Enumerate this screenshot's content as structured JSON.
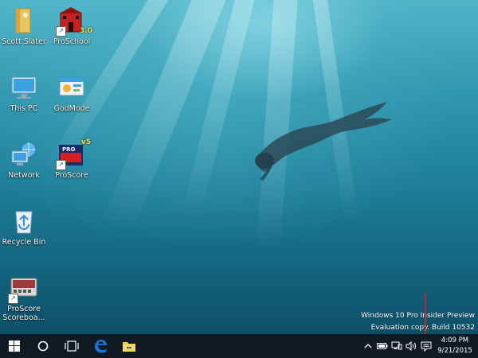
{
  "desktop": {
    "icons": [
      {
        "label": "Scott Slater",
        "icon": "user-folder-icon"
      },
      {
        "label": "ProSchool",
        "icon": "proschool-app-icon",
        "badge": "3.0"
      },
      {
        "label": "This PC",
        "icon": "computer-icon"
      },
      {
        "label": "GodMode",
        "icon": "control-panel-folder-icon"
      },
      {
        "label": "Network",
        "icon": "network-icon"
      },
      {
        "label": "ProScore",
        "icon": "proscore-app-icon",
        "badge": "v5"
      },
      {
        "label": "Recycle Bin",
        "icon": "recycle-bin-icon"
      },
      {
        "label": "ProScore Scoreboa...",
        "label_line1": "ProScore",
        "label_line2": "Scoreboa...",
        "icon": "scoreboard-app-icon"
      }
    ],
    "watermark": {
      "line1": "Windows 10 Pro Insider Preview",
      "line2": "Evaluation copy. Build 10532"
    }
  },
  "taskbar": {
    "buttons": [
      {
        "name": "start",
        "icon": "windows-logo-icon"
      },
      {
        "name": "search",
        "icon": "cortana-circle-icon"
      },
      {
        "name": "task-view",
        "icon": "task-view-icon"
      },
      {
        "name": "edge",
        "icon": "edge-browser-icon"
      },
      {
        "name": "file-explorer",
        "icon": "folder-icon"
      }
    ],
    "tray": {
      "icons": [
        "chevron-up-icon",
        "battery-icon",
        "network-icon",
        "volume-icon",
        "action-center-icon"
      ],
      "time": "4:09 PM",
      "date": "9/21/2015"
    }
  },
  "colors": {
    "taskbar": "#111922",
    "accent": "#1a73d9",
    "annotation_arrow": "#e02020"
  }
}
